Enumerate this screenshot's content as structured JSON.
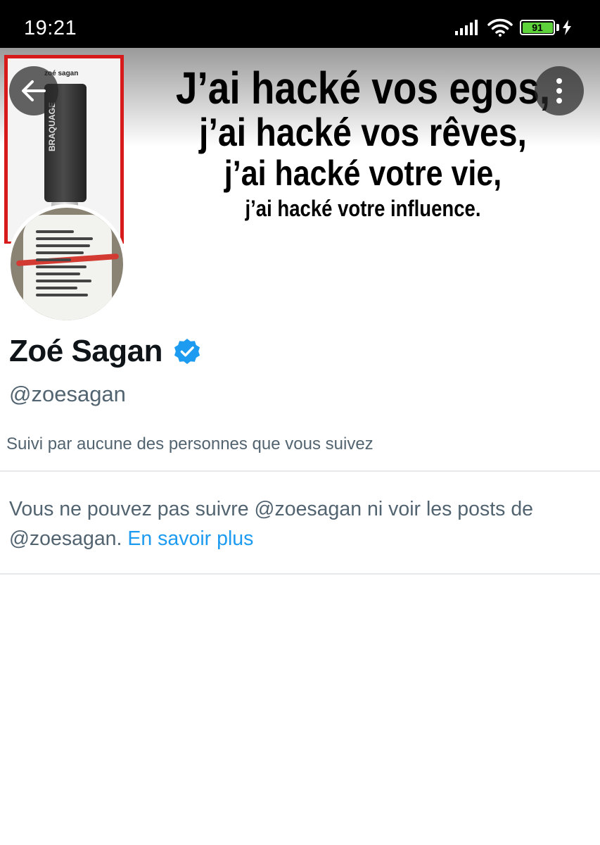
{
  "status_bar": {
    "time": "19:21",
    "battery_level": "91",
    "signal_icon": "cellular-signal-icon",
    "wifi_icon": "wifi-icon",
    "charging_icon": "charging-bolt-icon"
  },
  "banner": {
    "poster_author": "zoé sagan",
    "poster_usb_label": "BRAQUAGE",
    "headline": [
      "J’ai hacké vos egos,",
      "j’ai hacké vos rêves,",
      "j’ai hacké votre vie,",
      "j’ai hacké votre influence."
    ]
  },
  "toolbar": {
    "back_icon": "arrow-left-icon",
    "more_icon": "more-vertical-icon"
  },
  "profile": {
    "display_name": "Zoé Sagan",
    "verified_icon": "verified-badge-icon",
    "handle": "@zoesagan",
    "followed_by": "Suivi par aucune des personnes que vous suivez"
  },
  "restriction": {
    "message": "Vous ne pouvez pas suivre @zoesagan ni voir les posts de @zoesagan.",
    "link_label": "En savoir plus"
  },
  "colors": {
    "accent": "#1d9bf0",
    "secondary_text": "#536471",
    "primary_text": "#0f1419",
    "battery": "#5ed23b"
  }
}
